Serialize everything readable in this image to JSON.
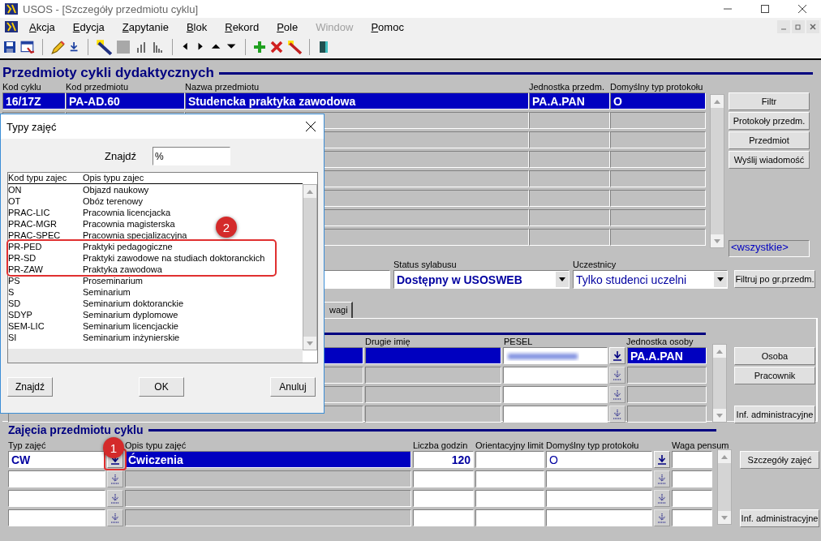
{
  "window": {
    "title": "USOS - [Szczegóły przedmiotu cyklu]"
  },
  "menu": [
    {
      "label": "Akcja",
      "disabled": false
    },
    {
      "label": "Edycja",
      "disabled": false
    },
    {
      "label": "Zapytanie",
      "disabled": false
    },
    {
      "label": "Blok",
      "disabled": false
    },
    {
      "label": "Rekord",
      "disabled": false
    },
    {
      "label": "Pole",
      "disabled": false
    },
    {
      "label": "Window",
      "disabled": true
    },
    {
      "label": "Pomoc",
      "disabled": false
    }
  ],
  "courses": {
    "title": "Przedmioty cykli dydaktycznych",
    "columns": [
      "Kod cyklu",
      "Kod przedmiotu",
      "Nazwa przedmiotu",
      "Jednostka przedm.",
      "Domyślny typ protokołu"
    ],
    "rows": [
      {
        "selected": true,
        "cells": [
          "16/17Z",
          "PA-AD.60",
          "Studencka praktyka zawodowa",
          "PA.A.PAN",
          "O"
        ]
      }
    ],
    "buttons": [
      "Filtr",
      "Protokoły przedm.",
      "Przedmiot",
      "Wyślij wiadomość"
    ],
    "group_value": "<wszystkie>"
  },
  "filters": {
    "status_label": "Status sylabusu",
    "status_value": "Dostępny w USOSWEB",
    "participants_label": "Uczestnicy",
    "participants_value": "Tylko studenci uczelni",
    "group_button": "Filtruj po gr.przedm."
  },
  "tabs": [
    {
      "label": "wagi"
    }
  ],
  "persons": {
    "columns": [
      "Drugie imię",
      "PESEL",
      "Jednostka osoby"
    ],
    "rows": [
      {
        "selected": true,
        "pesel_blurred": true,
        "unit": "PA.A.PAN"
      },
      {
        "selected": false
      },
      {
        "selected": false
      },
      {
        "selected": false
      }
    ],
    "buttons": [
      "Osoba",
      "Pracownik",
      "Inf. administracyjne"
    ]
  },
  "classes": {
    "title": "Zajęcia przedmiotu cyklu",
    "columns": [
      "Typ zajęć",
      "Opis typu zajęć",
      "Liczba godzin",
      "Orientacyjny limit",
      "Domyślny typ protokołu",
      "Waga pensum"
    ],
    "rows": [
      {
        "selected": true,
        "marked": true,
        "type": "CW",
        "description": "Ćwiczenia",
        "hours": "120",
        "protocol": "O"
      },
      {
        "selected": false,
        "marked": false
      },
      {
        "selected": false,
        "marked": false
      },
      {
        "selected": false,
        "marked": false
      }
    ],
    "buttons": [
      "Szczegóły zajęć",
      "Inf. administracyjne"
    ]
  },
  "dialog": {
    "title": "Typy zajęć",
    "search_label": "Znajdź",
    "search_value": "%",
    "columns": [
      "Kod typu zajec",
      "Opis typu zajec"
    ],
    "items": [
      {
        "code": "ON",
        "description": "Objazd naukowy",
        "highlighted": false
      },
      {
        "code": "OT",
        "description": "Obóz terenowy",
        "highlighted": false
      },
      {
        "code": "PRAC-LIC",
        "description": "Pracownia licencjacka",
        "highlighted": false
      },
      {
        "code": "PRAC-MGR",
        "description": "Pracownia magisterska",
        "highlighted": false
      },
      {
        "code": "PRAC-SPEC",
        "description": "Pracownia specjalizacyjna",
        "highlighted": false
      },
      {
        "code": "PR-PED",
        "description": "Praktyki pedagogiczne",
        "highlighted": true
      },
      {
        "code": "PR-SD",
        "description": "Praktyki zawodowe na studiach doktoranckich",
        "highlighted": true
      },
      {
        "code": "PR-ZAW",
        "description": "Praktyka zawodowa",
        "highlighted": true
      },
      {
        "code": "PS",
        "description": "Proseminarium",
        "highlighted": false
      },
      {
        "code": "S",
        "description": "Seminarium",
        "highlighted": false
      },
      {
        "code": "SD",
        "description": "Seminarium doktoranckie",
        "highlighted": false
      },
      {
        "code": "SDYP",
        "description": "Seminarium dyplomowe",
        "highlighted": false
      },
      {
        "code": "SEM-LIC",
        "description": "Seminarium licencjackie",
        "highlighted": false
      },
      {
        "code": "SI",
        "description": "Seminarium inżynierskie",
        "highlighted": false
      }
    ],
    "buttons": [
      "Znajdź",
      "OK",
      "Anuluj"
    ]
  },
  "annotations": [
    {
      "label": "1"
    },
    {
      "label": "2"
    }
  ]
}
